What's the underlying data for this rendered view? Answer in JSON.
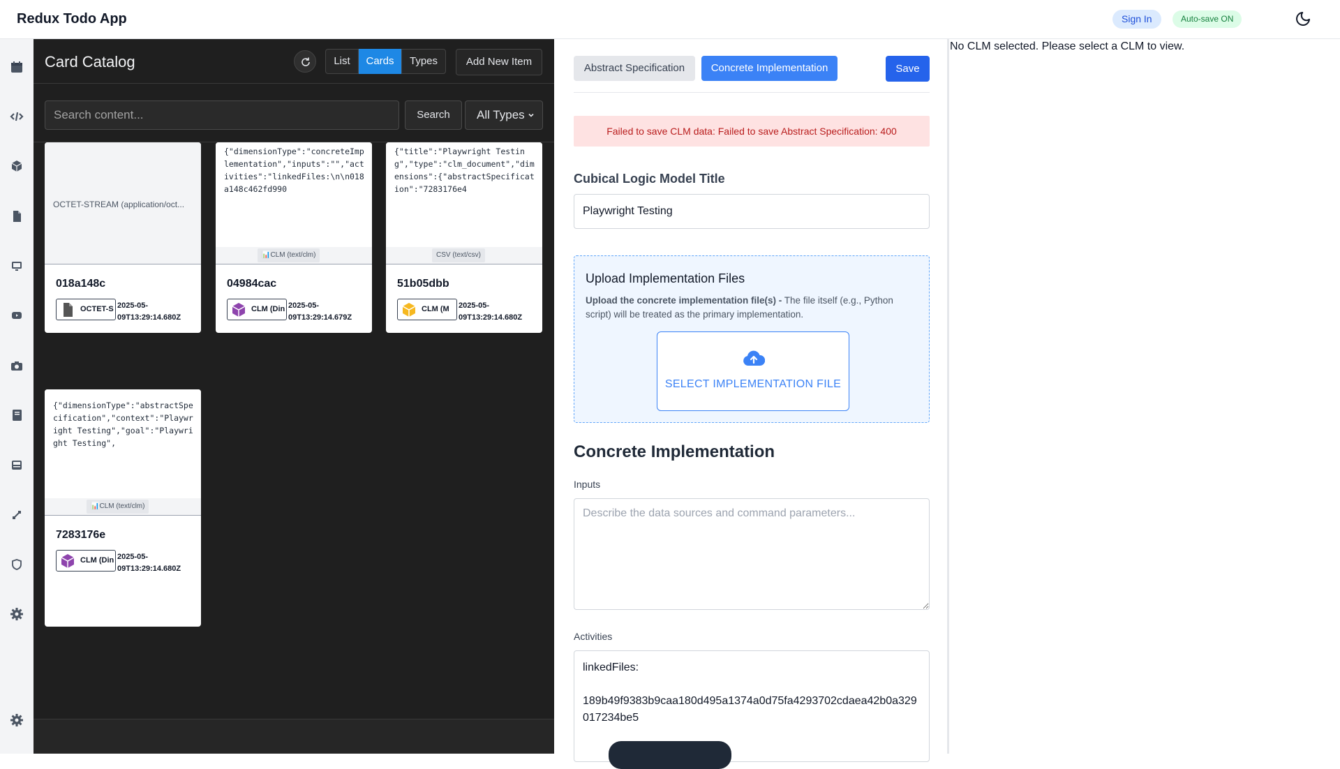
{
  "header": {
    "app_title": "Redux Todo App",
    "sign_in": "Sign In",
    "autosave": "Auto-save ON",
    "theme_icon": "moon-icon"
  },
  "rail": {
    "icons": [
      "calendar-icon",
      "code-icon",
      "cube-icon",
      "document-icon",
      "monitor-icon",
      "video-icon",
      "camera-icon",
      "book-icon",
      "inbox-icon",
      "diagram-icon",
      "shield-icon",
      "settings-icon",
      "settings-icon"
    ]
  },
  "catalog": {
    "title": "Card Catalog",
    "view_modes": {
      "list": "List",
      "cards": "Cards",
      "types": "Types",
      "active": "Cards"
    },
    "add_new": "Add New Item",
    "search_placeholder": "Search content...",
    "search_button": "Search",
    "type_filter": "All Types",
    "cards": [
      {
        "id": "018a148c",
        "preview": "",
        "mime": "",
        "octet_label": "OCTET-STREAM (application/oct...",
        "badge": "OCTET-S",
        "badge_icon": "file-icon",
        "date": "2025-05-09T13:29:14.680Z"
      },
      {
        "id": "04984cac",
        "preview": "{\"dimensionType\":\"concreteImplementation\",\"inputs\":\"\",\"activities\":\"linkedFiles:\\n\\n018a148c462fd990",
        "mime": "📊CLM (text/clm)",
        "badge": "CLM (Din",
        "badge_icon": "purple-cube-icon",
        "date": "2025-05-09T13:29:14.679Z"
      },
      {
        "id": "51b05dbb",
        "preview": "{\"title\":\"Playwright Testing\",\"type\":\"clm_document\",\"dimensions\":{\"abstractSpecification\":\"7283176e4",
        "mime": "CSV (text/csv)",
        "badge": "CLM (M",
        "badge_icon": "yellow-cube-icon",
        "date": "2025-05-09T13:29:14.680Z"
      },
      {
        "id": "7283176e",
        "preview": "{\"dimensionType\":\"abstractSpecification\",\"context\":\"Playwright Testing\",\"goal\":\"Playwright Testing\",",
        "mime": "📊CLM (text/clm)",
        "badge": "CLM (Din",
        "badge_icon": "purple-cube-icon",
        "date": "2025-05-09T13:29:14.680Z"
      }
    ]
  },
  "form": {
    "tabs": {
      "abstract": "Abstract Specification",
      "concrete": "Concrete Implementation",
      "active": "Concrete Implementation"
    },
    "save": "Save",
    "error": "Failed to save CLM data: Failed to save Abstract Specification: 400",
    "title_label": "Cubical Logic Model Title",
    "title_value": "Playwright Testing",
    "upload": {
      "title": "Upload Implementation Files",
      "desc_bold": "Upload the concrete implementation file(s) -",
      "desc_rest": " The file itself (e.g., Python script) will be treated as the primary implementation.",
      "button": "SELECT IMPLEMENTATION FILE"
    },
    "section_title": "Concrete Implementation",
    "inputs_label": "Inputs",
    "inputs_placeholder": "Describe the data sources and command parameters...",
    "activities_label": "Activities",
    "activities_line1": "linkedFiles:",
    "activities_hash": "189b49f9383b9caa180d495a1374a0d75fa4293702cdaea42b0a329017234be5"
  },
  "viewer": {
    "empty": "No CLM selected. Please select a CLM to view."
  },
  "colors": {
    "primary": "#2563eb",
    "active_tab": "#3b82f6",
    "catalog_bg": "#1f1f1f",
    "error_bg": "#fee2e2",
    "error_text": "#b91c1c"
  }
}
